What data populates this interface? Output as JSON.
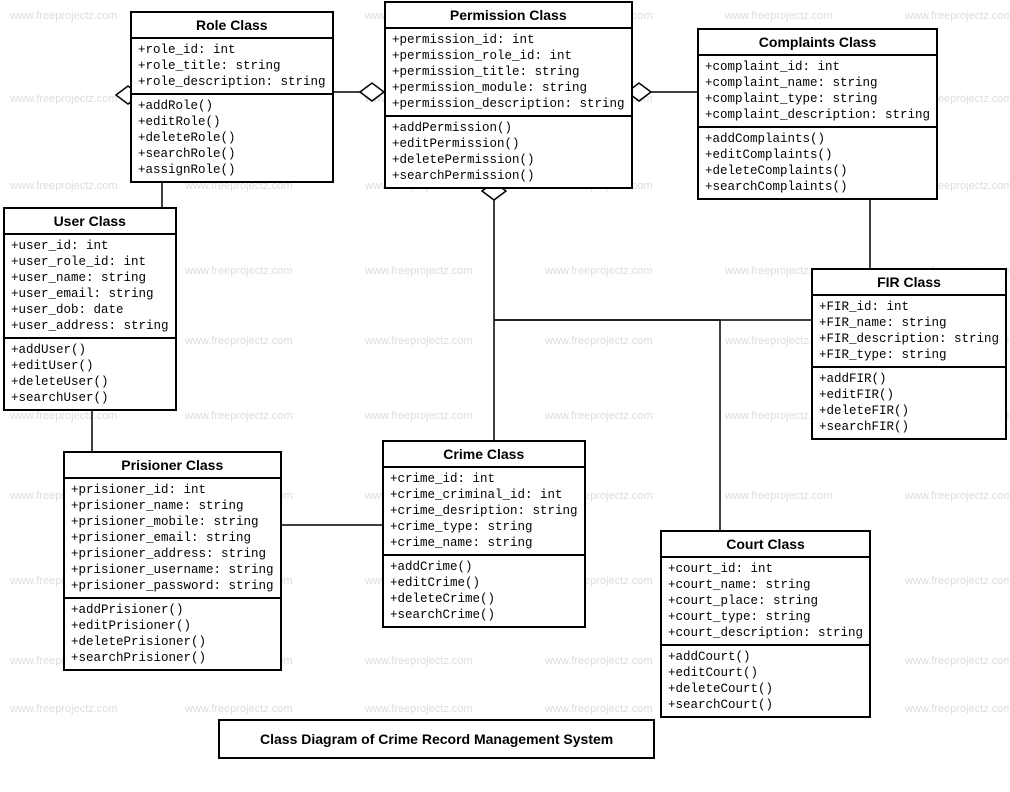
{
  "title": "Class Diagram of Crime Record Management System",
  "watermark": "www.freeprojectz.com",
  "classes": {
    "role": {
      "name": "Role Class",
      "attributes": [
        "+role_id: int",
        "+role_title: string",
        "+role_description: string"
      ],
      "methods": [
        "+addRole()",
        "+editRole()",
        "+deleteRole()",
        "+searchRole()",
        "+assignRole()"
      ]
    },
    "permission": {
      "name": "Permission Class",
      "attributes": [
        "+permission_id: int",
        "+permission_role_id: int",
        "+permission_title: string",
        "+permission_module: string",
        "+permission_description: string"
      ],
      "methods": [
        "+addPermission()",
        "+editPermission()",
        "+deletePermission()",
        "+searchPermission()"
      ]
    },
    "complaints": {
      "name": "Complaints Class",
      "attributes": [
        "+complaint_id: int",
        "+complaint_name: string",
        "+complaint_type: string",
        "+complaint_description: string"
      ],
      "methods": [
        "+addComplaints()",
        "+editComplaints()",
        "+deleteComplaints()",
        "+searchComplaints()"
      ]
    },
    "user": {
      "name": "User Class",
      "attributes": [
        "+user_id: int",
        "+user_role_id: int",
        "+user_name: string",
        "+user_email: string",
        "+user_dob: date",
        "+user_address: string"
      ],
      "methods": [
        "+addUser()",
        "+editUser()",
        "+deleteUser()",
        "+searchUser()"
      ]
    },
    "fir": {
      "name": "FIR Class",
      "attributes": [
        "+FIR_id: int",
        "+FIR_name: string",
        "+FIR_description: string",
        "+FIR_type: string"
      ],
      "methods": [
        "+addFIR()",
        "+editFIR()",
        "+deleteFIR()",
        "+searchFIR()"
      ]
    },
    "prisioner": {
      "name": "Prisioner Class",
      "attributes": [
        "+prisioner_id: int",
        "+prisioner_name: string",
        "+prisioner_mobile: string",
        "+prisioner_email: string",
        "+prisioner_address: string",
        "+prisioner_username: string",
        "+prisioner_password: string"
      ],
      "methods": [
        "+addPrisioner()",
        "+editPrisioner()",
        "+deletePrisioner()",
        "+searchPrisioner()"
      ]
    },
    "crime": {
      "name": "Crime Class",
      "attributes": [
        "+crime_id: int",
        "+crime_criminal_id: int",
        "+crime_desription: string",
        "+crime_type: string",
        "+crime_name: string"
      ],
      "methods": [
        "+addCrime()",
        "+editCrime()",
        "+deleteCrime()",
        "+searchCrime()"
      ]
    },
    "court": {
      "name": "Court Class",
      "attributes": [
        "+court_id: int",
        "+court_name: string",
        "+court_place: string",
        "+court_type: string",
        "+court_description: string"
      ],
      "methods": [
        "+addCourt()",
        "+editCourt()",
        "+deleteCourt()",
        "+searchCourt()"
      ]
    }
  }
}
